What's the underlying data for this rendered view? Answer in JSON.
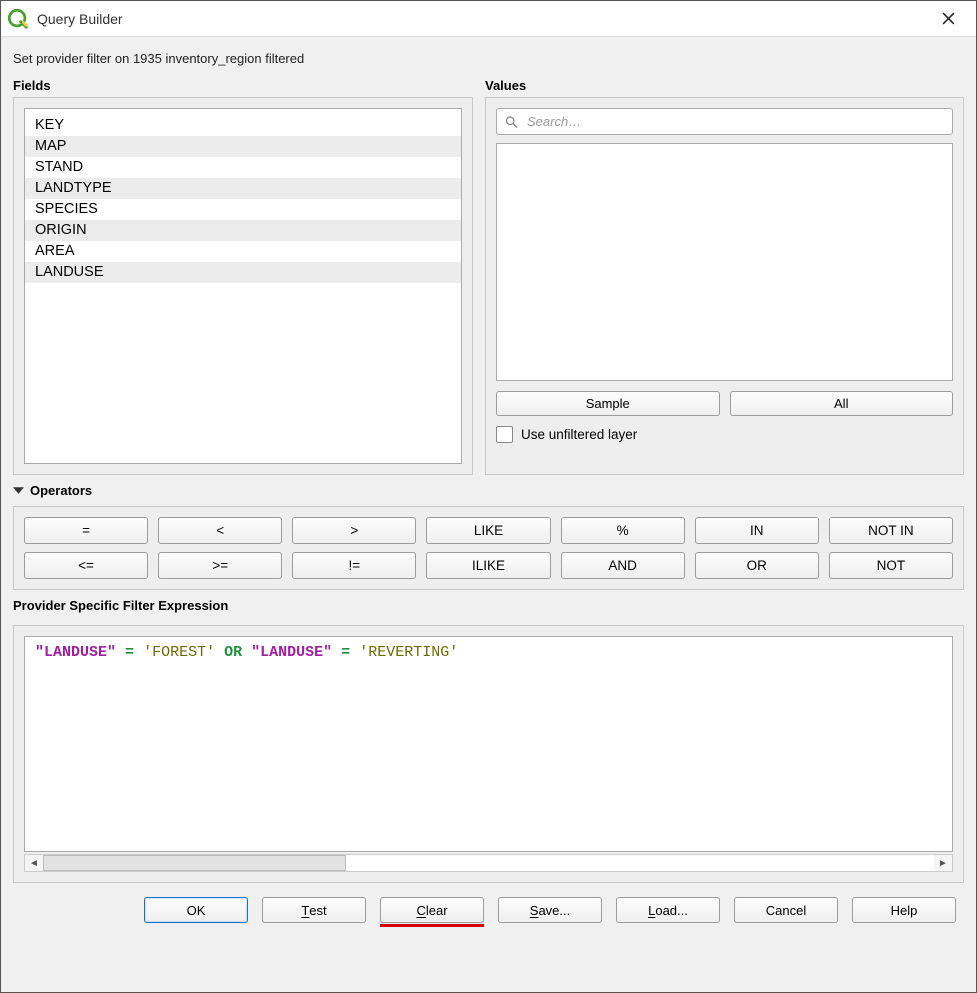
{
  "window": {
    "title": "Query Builder"
  },
  "subtitle": "Set provider filter on 1935 inventory_region filtered",
  "fields": {
    "label": "Fields",
    "items": [
      "KEY",
      "MAP",
      "STAND",
      "LANDTYPE",
      "SPECIES",
      "ORIGIN",
      "AREA",
      "LANDUSE"
    ]
  },
  "values": {
    "label": "Values",
    "search_placeholder": "Search…",
    "sample_label": "Sample",
    "all_label": "All",
    "use_unfiltered_label": "Use unfiltered layer"
  },
  "operators": {
    "label": "Operators",
    "row1": [
      "=",
      "<",
      ">",
      "LIKE",
      "%",
      "IN",
      "NOT IN"
    ],
    "row2": [
      "<=",
      ">=",
      "!=",
      "ILIKE",
      "AND",
      "OR",
      "NOT"
    ]
  },
  "expression": {
    "label": "Provider Specific Filter Expression",
    "tokens": [
      {
        "t": "fld",
        "v": "\"LANDUSE\""
      },
      {
        "t": "sp",
        "v": " "
      },
      {
        "t": "op",
        "v": "="
      },
      {
        "t": "sp",
        "v": " "
      },
      {
        "t": "str",
        "v": "'FOREST'"
      },
      {
        "t": "sp",
        "v": " "
      },
      {
        "t": "op",
        "v": "OR"
      },
      {
        "t": "sp",
        "v": " "
      },
      {
        "t": "fld",
        "v": "\"LANDUSE\""
      },
      {
        "t": "sp",
        "v": " "
      },
      {
        "t": "op",
        "v": "="
      },
      {
        "t": "sp",
        "v": " "
      },
      {
        "t": "str",
        "v": "'REVERTING'"
      }
    ]
  },
  "footer": {
    "ok": "OK",
    "test": "Test",
    "clear": "Clear",
    "save": "Save...",
    "load": "Load...",
    "cancel": "Cancel",
    "help": "Help"
  }
}
